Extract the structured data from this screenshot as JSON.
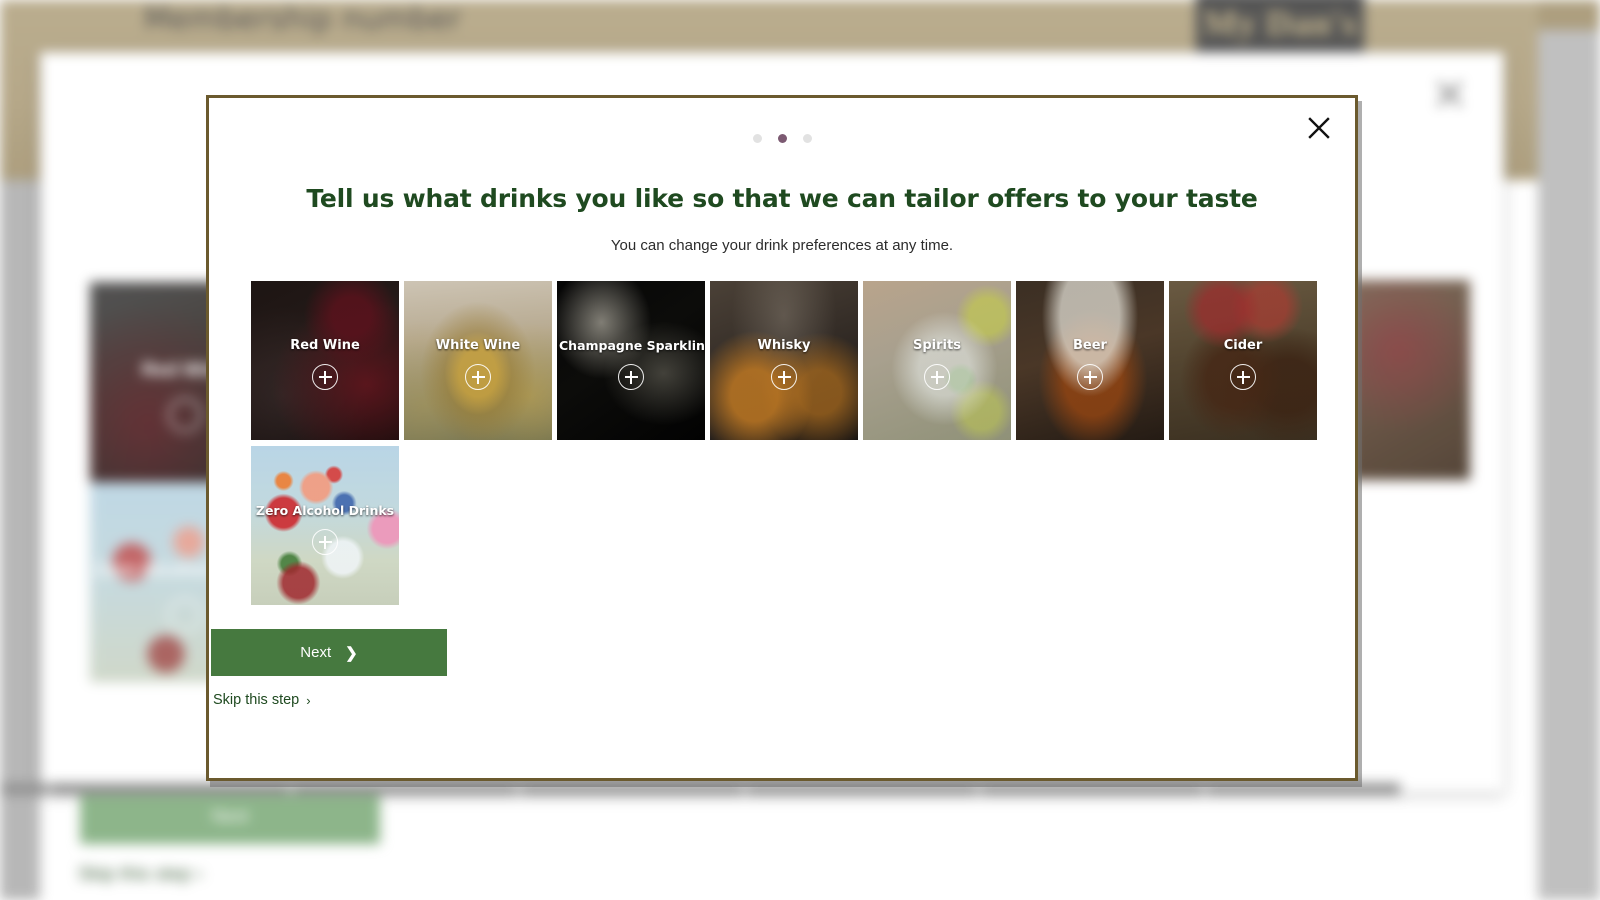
{
  "background": {
    "band_label": "Membership number",
    "logo_text": "My Dan's",
    "close_icon": "close-icon",
    "blurred_modal": {
      "tiles": [
        {
          "label": "Red Wine",
          "theme": "red"
        },
        {
          "label": "Zero Alcohol Drinks",
          "theme": "zero"
        }
      ],
      "next_label": "Next",
      "skip_label": "Skip this step  ›"
    }
  },
  "modal": {
    "close_icon": "close-icon",
    "close_label": "Close",
    "dots": {
      "count": 3,
      "active_index": 1,
      "active_color": "#7c5a72",
      "inactive_color": "#e2e2e2"
    },
    "title": "Tell us what drinks you like so that we can tailor offers to your taste",
    "subtitle": "You can change your drink preferences at any time.",
    "title_color": "#1f4a20",
    "tiles": [
      {
        "label": "Red Wine",
        "photo": "red-wine-photo",
        "add_icon": "plus-icon"
      },
      {
        "label": "White Wine",
        "photo": "white-wine-photo",
        "add_icon": "plus-icon"
      },
      {
        "label": "Champagne Sparkling",
        "photo": "champagne-sparkling-photo",
        "add_icon": "plus-icon"
      },
      {
        "label": "Whisky",
        "photo": "whisky-photo",
        "add_icon": "plus-icon"
      },
      {
        "label": "Spirits",
        "photo": "spirits-photo",
        "add_icon": "plus-icon"
      },
      {
        "label": "Beer",
        "photo": "beer-photo",
        "add_icon": "plus-icon"
      },
      {
        "label": "Cider",
        "photo": "cider-photo",
        "add_icon": "plus-icon"
      },
      {
        "label": "Zero Alcohol Drinks",
        "photo": "zero-alcohol-drinks-photo",
        "add_icon": "plus-icon"
      }
    ],
    "next_button": {
      "label": "Next",
      "chevron": "❯",
      "color": "#46793f"
    },
    "skip_link": {
      "label": "Skip this step",
      "chevron": "›"
    }
  }
}
